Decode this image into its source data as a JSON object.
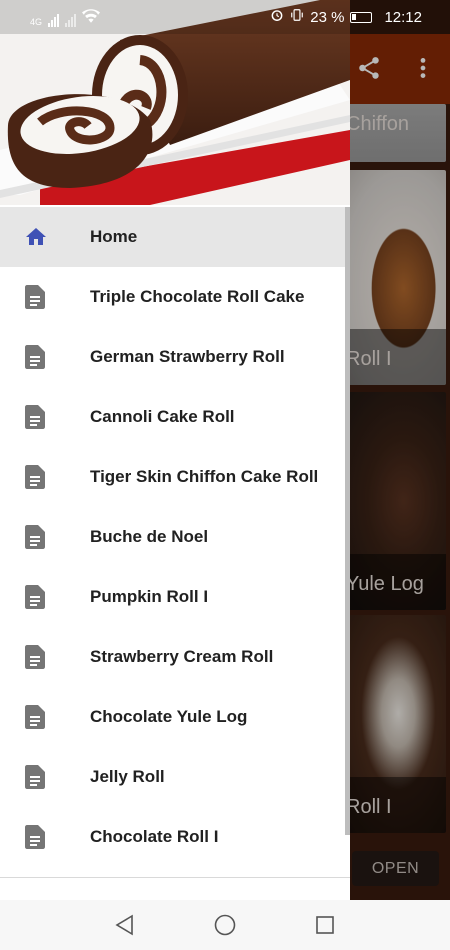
{
  "status_bar": {
    "network": "4G",
    "battery_percent": "23 %",
    "time": "12:12"
  },
  "background_app": {
    "card_captions": [
      "Chiffon",
      "Roll I",
      "Yule Log",
      "Roll I"
    ],
    "open_button": "OPEN",
    "toolbar_icons": [
      "share-icon",
      "more-vert-icon"
    ]
  },
  "drawer": {
    "header_image": "chocolate-roll-cake-image",
    "items": [
      {
        "label": "Home",
        "icon": "home-icon",
        "active": true
      },
      {
        "label": "Triple Chocolate Roll Cake",
        "icon": "document-icon"
      },
      {
        "label": "German Strawberry Roll",
        "icon": "document-icon"
      },
      {
        "label": "Cannoli Cake Roll",
        "icon": "document-icon"
      },
      {
        "label": "Tiger Skin Chiffon Cake Roll",
        "icon": "document-icon"
      },
      {
        "label": "Buche de Noel",
        "icon": "document-icon"
      },
      {
        "label": "Pumpkin Roll I",
        "icon": "document-icon"
      },
      {
        "label": "Strawberry Cream Roll",
        "icon": "document-icon"
      },
      {
        "label": "Chocolate Yule Log",
        "icon": "document-icon"
      },
      {
        "label": "Jelly Roll",
        "icon": "document-icon"
      },
      {
        "label": "Chocolate Roll I",
        "icon": "document-icon"
      }
    ]
  },
  "nav_bar": {
    "buttons": [
      "back-icon",
      "home-circle-icon",
      "recents-icon"
    ]
  },
  "colors": {
    "accent": "#3f51b5",
    "icon_gray": "#757575",
    "toolbar": "#8a2a06",
    "active_item_bg": "#e6e6e6"
  }
}
